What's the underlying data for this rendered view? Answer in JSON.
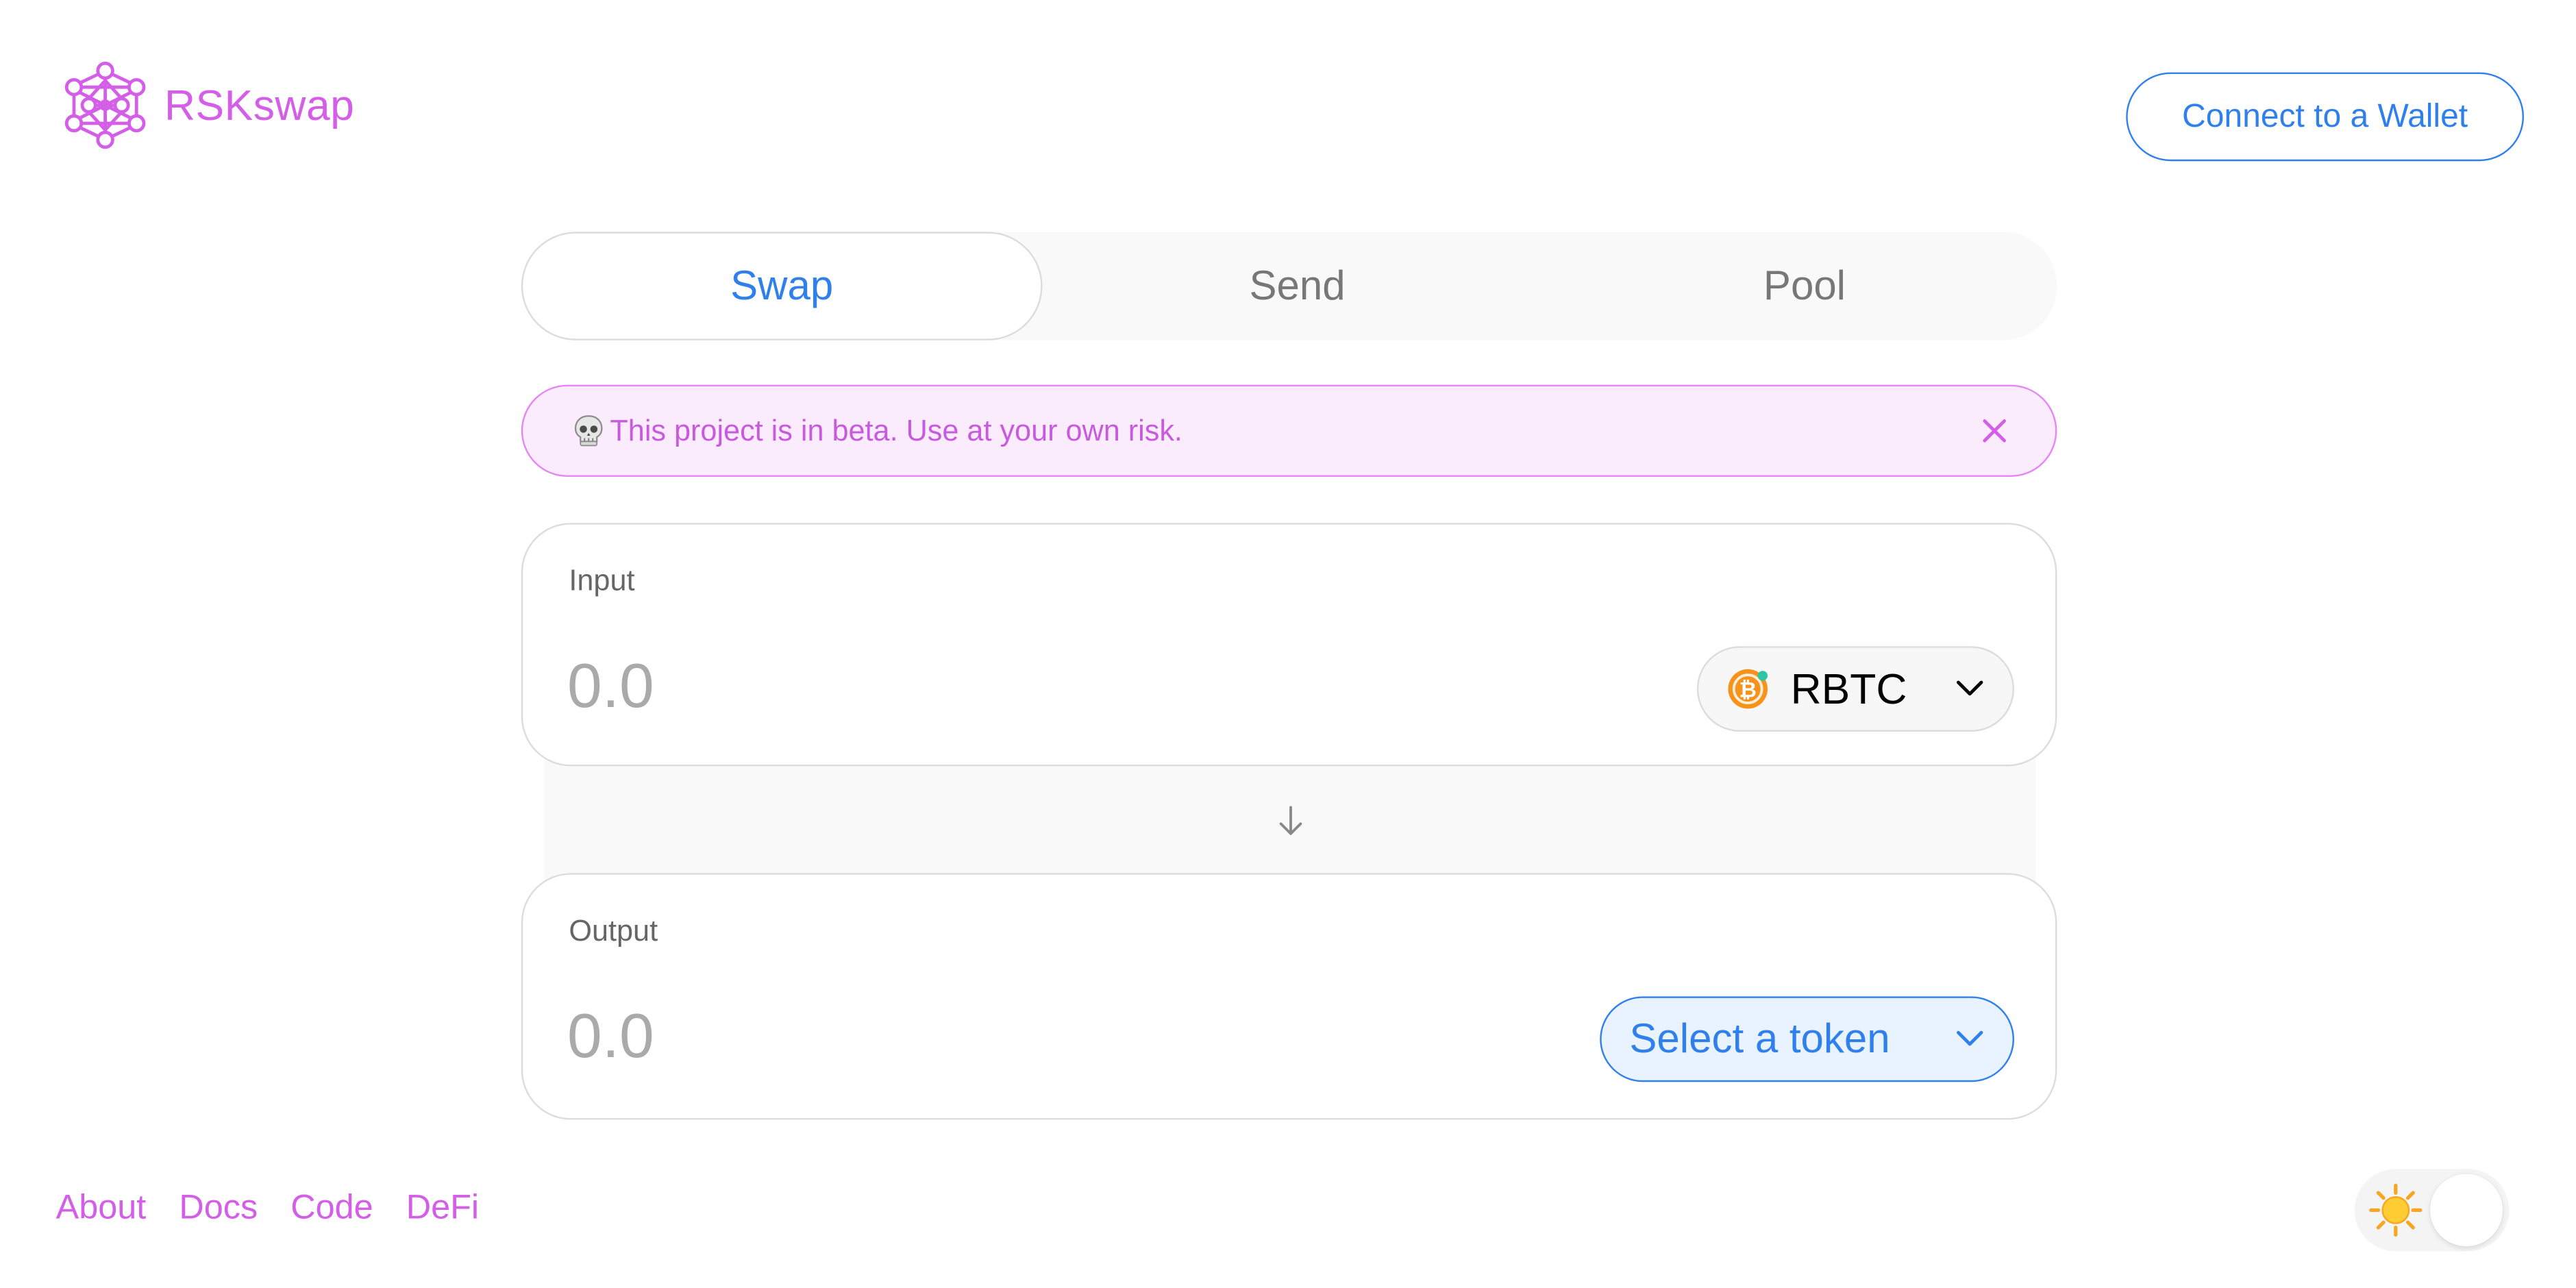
{
  "header": {
    "app_name": "RSKswap",
    "connect_label": "Connect to a Wallet"
  },
  "tabs": [
    {
      "label": "Swap",
      "active": true
    },
    {
      "label": "Send",
      "active": false
    },
    {
      "label": "Pool",
      "active": false
    }
  ],
  "warning": {
    "icon": "skull-icon",
    "text": "This project is in beta. Use at your own risk."
  },
  "input": {
    "label": "Input",
    "placeholder": "0.0",
    "token": "RBTC",
    "token_icon": "rbtc-icon"
  },
  "output": {
    "label": "Output",
    "placeholder": "0.0",
    "token_select_label": "Select a token"
  },
  "footer": {
    "links": [
      "About",
      "Docs",
      "Code",
      "DeFi"
    ],
    "theme_icon": "sun-icon"
  },
  "colors": {
    "brand_pink": "#d45ee8",
    "accent_blue": "#2f80ed",
    "warning_bg": "#fbecfd",
    "rbtc_orange": "#f7931a"
  }
}
